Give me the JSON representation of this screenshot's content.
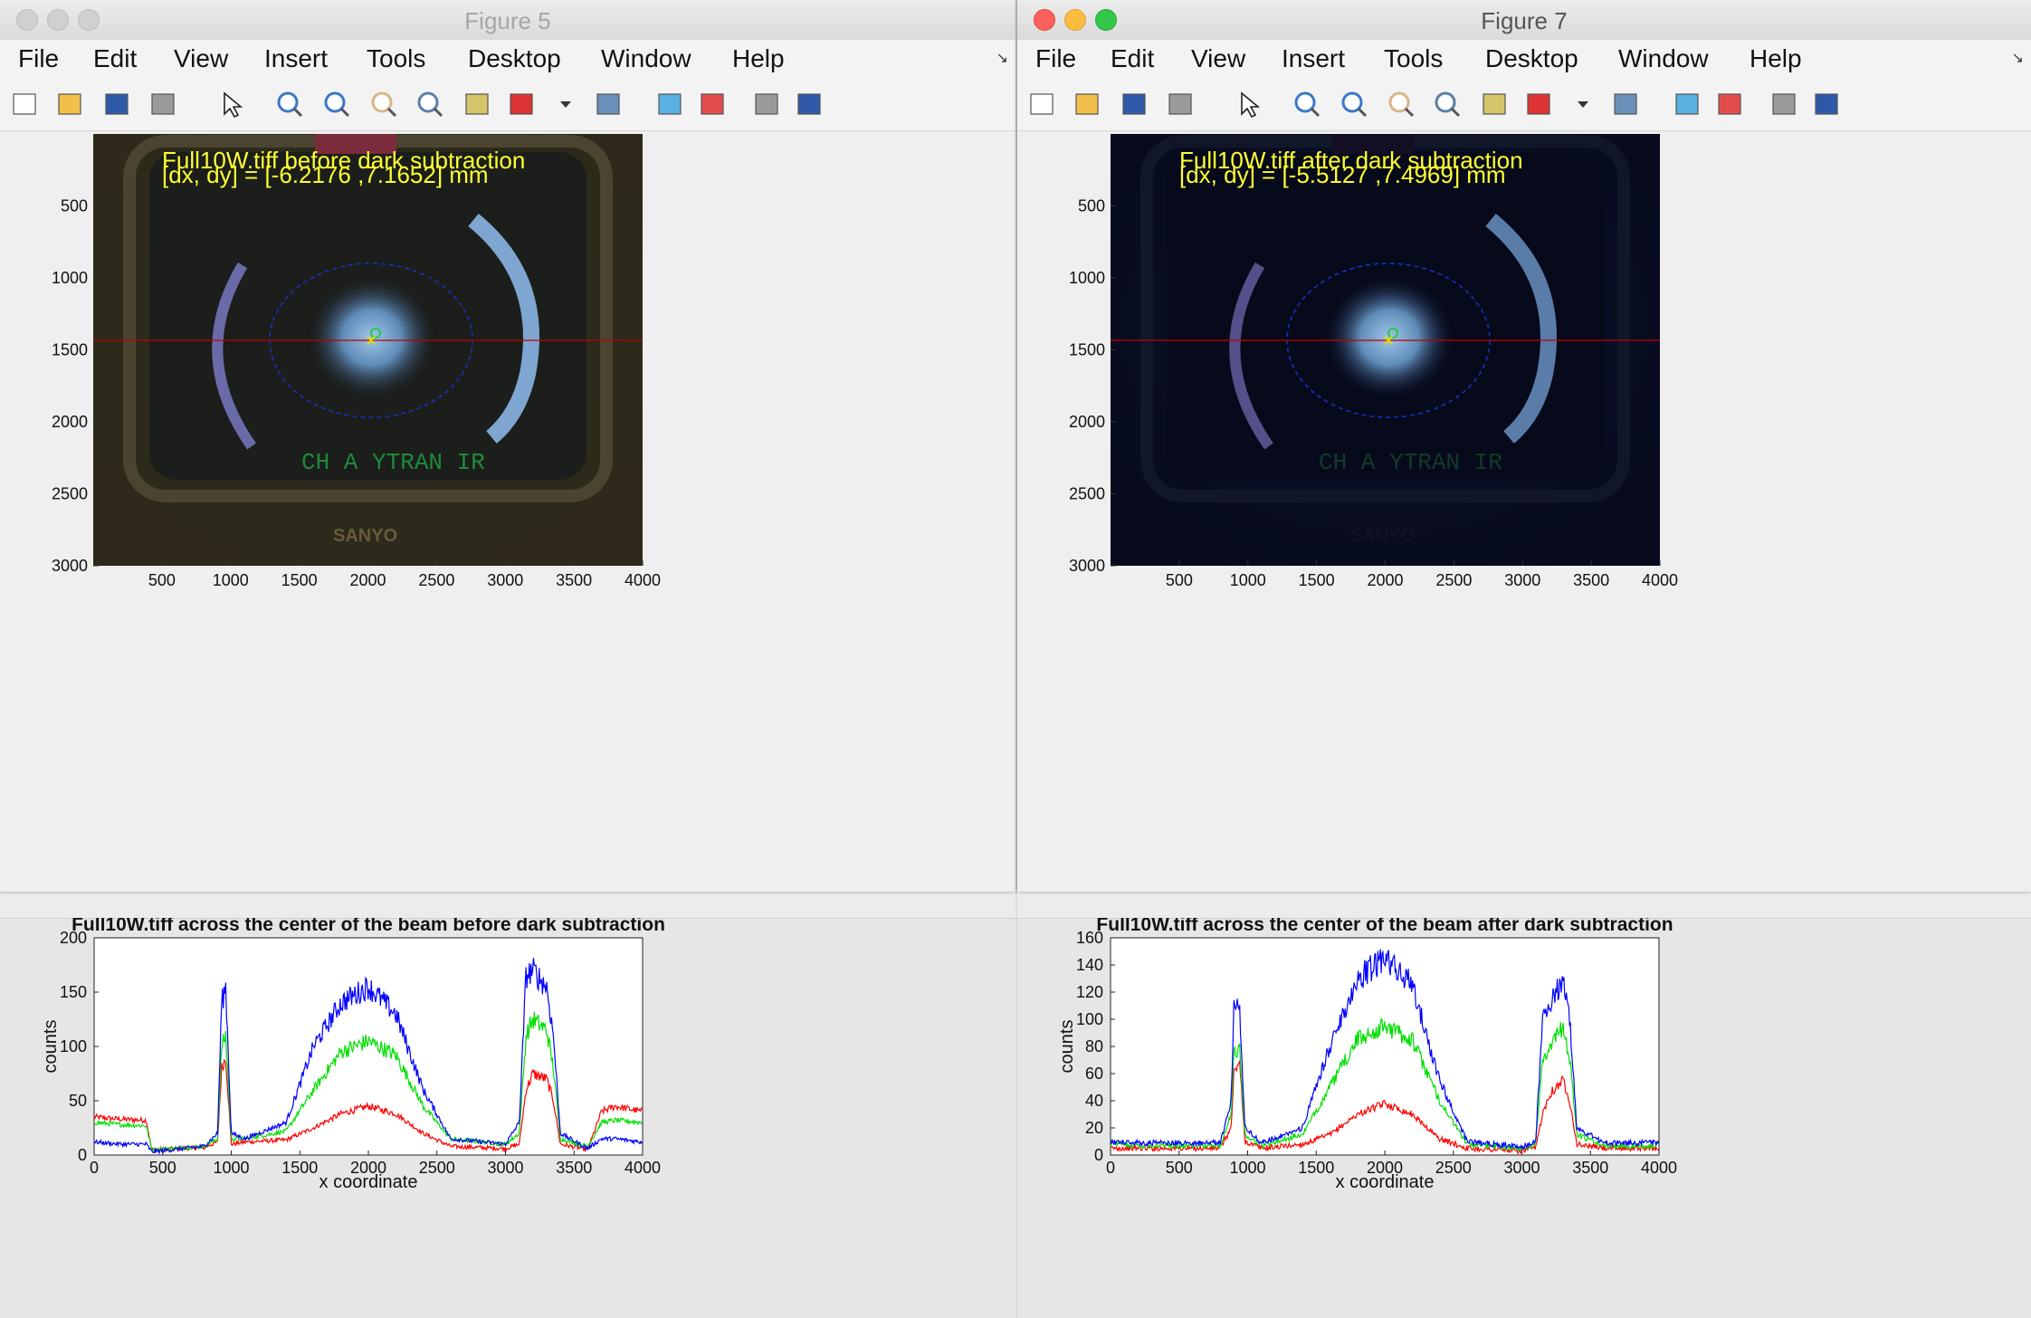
{
  "menu": [
    "File",
    "Edit",
    "View",
    "Insert",
    "Tools",
    "Desktop",
    "Window",
    "Help"
  ],
  "toolbar_icons": [
    "new-figure-icon",
    "open-icon",
    "save-icon",
    "print-icon",
    "pointer-icon",
    "zoom-in-icon",
    "zoom-out-icon",
    "pan-icon",
    "rotate-icon",
    "data-cursor-icon",
    "brush-icon",
    "brush-dropdown-icon",
    "link-icon",
    "colorbar-icon",
    "legend-icon",
    "hide-tools-icon",
    "show-tools-icon"
  ],
  "windows": [
    {
      "title": "Figure 5",
      "active": false,
      "overlay_line1": "Full10W.tiff before dark subtraction",
      "overlay_line2": "[dx, dy] = [-6.2176 ,7.1652] mm",
      "monitor_text": "CH A YTRAN IR",
      "brand_text": "SANYO",
      "image_yticks": [
        "500",
        "1000",
        "1500",
        "2000",
        "2500",
        "3000"
      ],
      "image_xticks": [
        "500",
        "1000",
        "1500",
        "2000",
        "2500",
        "3000",
        "3500",
        "4000"
      ]
    },
    {
      "title": "Figure 7",
      "active": true,
      "overlay_line1": "Full10W.tiff after dark subtraction",
      "overlay_line2": "[dx, dy] = [-5.5127 ,7.4969] mm",
      "monitor_text": "CH A YTRAN IR",
      "brand_text": "SANYO",
      "image_yticks": [
        "500",
        "1000",
        "1500",
        "2000",
        "2500",
        "3000"
      ],
      "image_xticks": [
        "500",
        "1000",
        "1500",
        "2000",
        "2500",
        "3000",
        "3500",
        "4000"
      ]
    }
  ],
  "colors": {
    "red": "#ff0000",
    "green": "#00e000",
    "blue": "#0000ff",
    "overlay": "#ffff33",
    "center_line": "#c00000"
  },
  "chart_data": [
    {
      "type": "line",
      "title": "Full10W.tiff across the center of the beam before dark subtraction",
      "xlabel": "x coordinate",
      "ylabel": "counts",
      "xlim": [
        0,
        4000
      ],
      "ylim": [
        0,
        200
      ],
      "xticks": [
        "0",
        "500",
        "1000",
        "1500",
        "2000",
        "2500",
        "3000",
        "3500",
        "4000"
      ],
      "yticks": [
        "0",
        "50",
        "100",
        "150",
        "200"
      ],
      "x": [
        0,
        200,
        380,
        420,
        800,
        900,
        930,
        960,
        1000,
        1100,
        1400,
        1600,
        1800,
        2000,
        2200,
        2400,
        2600,
        3000,
        3100,
        3150,
        3200,
        3300,
        3350,
        3400,
        3600,
        3700,
        3800,
        4000
      ],
      "series": [
        {
          "color": "red",
          "values": [
            35,
            33,
            32,
            5,
            7,
            12,
            80,
            90,
            10,
            12,
            14,
            25,
            38,
            45,
            38,
            20,
            8,
            6,
            10,
            60,
            75,
            70,
            50,
            10,
            5,
            40,
            45,
            40
          ]
        },
        {
          "color": "green",
          "values": [
            30,
            28,
            27,
            5,
            8,
            15,
            100,
            110,
            15,
            15,
            22,
            60,
            95,
            105,
            92,
            45,
            15,
            10,
            20,
            110,
            125,
            115,
            80,
            15,
            8,
            30,
            32,
            30
          ]
        },
        {
          "color": "blue",
          "values": [
            12,
            10,
            10,
            3,
            8,
            20,
            140,
            155,
            20,
            15,
            30,
            100,
            140,
            155,
            130,
            60,
            15,
            10,
            30,
            165,
            170,
            155,
            110,
            20,
            6,
            15,
            15,
            12
          ]
        }
      ]
    },
    {
      "type": "line",
      "title": "Full10W.tiff across the center of the beam after dark subtraction",
      "xlabel": "x coordinate",
      "ylabel": "counts",
      "xlim": [
        0,
        4000
      ],
      "ylim": [
        0,
        160
      ],
      "xticks": [
        "0",
        "500",
        "1000",
        "1500",
        "2000",
        "2500",
        "3000",
        "3500",
        "4000"
      ],
      "yticks": [
        "0",
        "20",
        "40",
        "60",
        "80",
        "100",
        "120",
        "140",
        "160"
      ],
      "x": [
        0,
        200,
        400,
        800,
        880,
        900,
        940,
        980,
        1100,
        1400,
        1600,
        1800,
        2000,
        2200,
        2400,
        2600,
        3000,
        3100,
        3150,
        3200,
        3300,
        3350,
        3400,
        3600,
        3800,
        4000
      ],
      "series": [
        {
          "color": "red",
          "values": [
            5,
            5,
            5,
            5,
            20,
            60,
            70,
            10,
            5,
            8,
            15,
            30,
            38,
            30,
            12,
            5,
            3,
            5,
            30,
            45,
            55,
            40,
            8,
            5,
            5,
            5
          ]
        },
        {
          "color": "green",
          "values": [
            8,
            7,
            7,
            7,
            30,
            75,
            80,
            15,
            7,
            15,
            50,
            85,
            95,
            85,
            40,
            8,
            5,
            8,
            70,
            80,
            95,
            70,
            15,
            7,
            7,
            7
          ]
        },
        {
          "color": "blue",
          "values": [
            10,
            9,
            9,
            9,
            40,
            110,
            115,
            20,
            9,
            20,
            80,
            130,
            145,
            125,
            55,
            10,
            6,
            10,
            100,
            110,
            130,
            100,
            20,
            9,
            9,
            9
          ]
        }
      ]
    }
  ]
}
